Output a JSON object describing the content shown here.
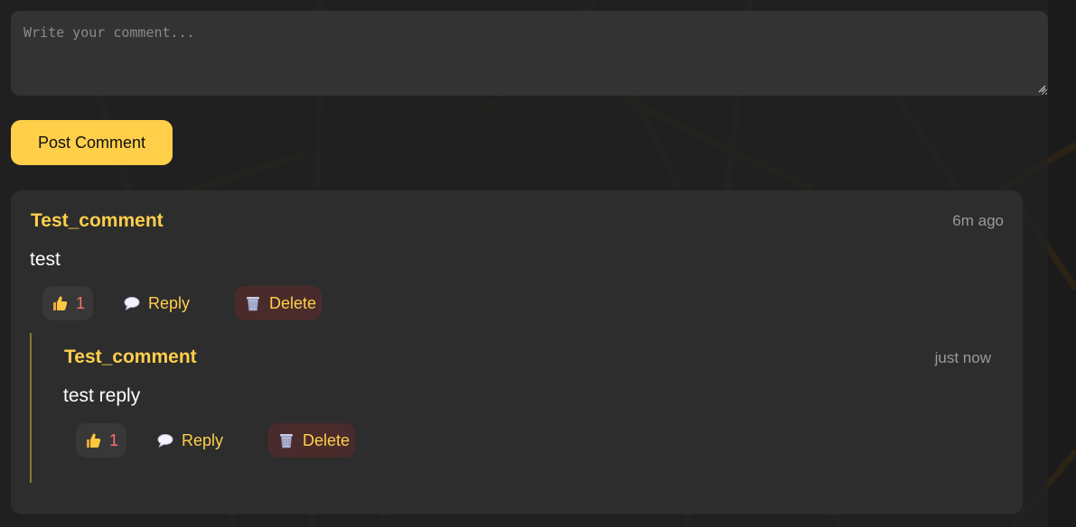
{
  "composer": {
    "placeholder": "Write your comment...",
    "post_label": "Post Comment"
  },
  "comments": [
    {
      "author": "Test_comment",
      "time": "6m ago",
      "text": "test",
      "likes": "1",
      "reply_label": "Reply",
      "delete_label": "Delete",
      "replies": [
        {
          "author": "Test_comment",
          "time": "just now",
          "text": "test reply",
          "likes": "1",
          "reply_label": "Reply",
          "delete_label": "Delete"
        }
      ]
    }
  ],
  "icons": {
    "like": "thumbs-up-icon",
    "reply": "speech-bubble-icon",
    "delete": "wastebasket-icon"
  },
  "colors": {
    "accent": "#ffcf4a",
    "like_count": "#ff7070",
    "delete_bg": "#4a2b2b",
    "card_bg": "#2d2d2d"
  }
}
